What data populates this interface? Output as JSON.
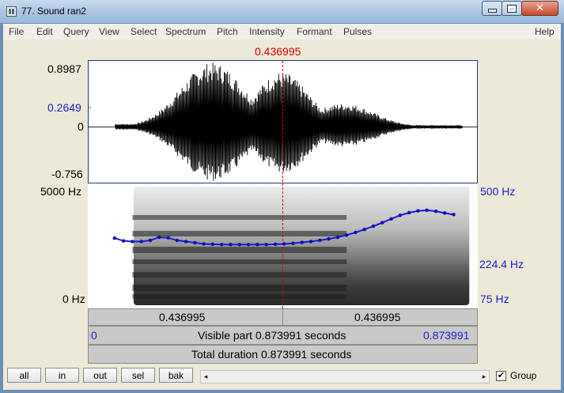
{
  "window": {
    "title": "77. Sound ran2",
    "close_glyph": "✕"
  },
  "menu": [
    "File",
    "Edit",
    "Query",
    "View",
    "Select",
    "Spectrum",
    "Pitch",
    "Intensity",
    "Formant",
    "Pulses",
    "Help"
  ],
  "cursor_time": "0.436995",
  "amplitude_axis": {
    "max": "0.8987",
    "cursor_value": "0.2649",
    "zero": "0",
    "min": "-0.756"
  },
  "spectrogram_axis": {
    "top": "5000 Hz",
    "bottom": "0 Hz"
  },
  "pitch_axis": {
    "top": "500 Hz",
    "mid": "224.4 Hz",
    "bottom": "75 Hz"
  },
  "time_bar": {
    "left": "0.436995",
    "right": "0.436995"
  },
  "visible_bar": {
    "start": "0",
    "text": "Visible part 0.873991 seconds",
    "end": "0.873991"
  },
  "total_bar": {
    "text": "Total duration 0.873991 seconds"
  },
  "buttons": {
    "all": "all",
    "in": "in",
    "out": "out",
    "sel": "sel",
    "bak": "bak"
  },
  "scroll": {
    "left": "◂",
    "right": "▸"
  },
  "group": {
    "label": "Group",
    "checked": "✔"
  },
  "colors": {
    "cursor": "#d40000",
    "pitch": "#1c1ccc",
    "frame": "#1a3b6b"
  },
  "pitch_contour": {
    "times_s": [
      0.06,
      0.08,
      0.1,
      0.12,
      0.14,
      0.16,
      0.18,
      0.2,
      0.22,
      0.24,
      0.26,
      0.28,
      0.3,
      0.32,
      0.34,
      0.36,
      0.38,
      0.4,
      0.42,
      0.44,
      0.46,
      0.48,
      0.5,
      0.52,
      0.54,
      0.56,
      0.58,
      0.6,
      0.62,
      0.64,
      0.66,
      0.68,
      0.7,
      0.72,
      0.74,
      0.76,
      0.78,
      0.8,
      0.82
    ],
    "hz": [
      215,
      205,
      203,
      203,
      207,
      218,
      216,
      207,
      203,
      199,
      195,
      194,
      193,
      193,
      193,
      193,
      193,
      193,
      194,
      195,
      197,
      200,
      203,
      207,
      212,
      218,
      226,
      236,
      248,
      262,
      278,
      296,
      314,
      328,
      338,
      342,
      336,
      326,
      318
    ]
  }
}
